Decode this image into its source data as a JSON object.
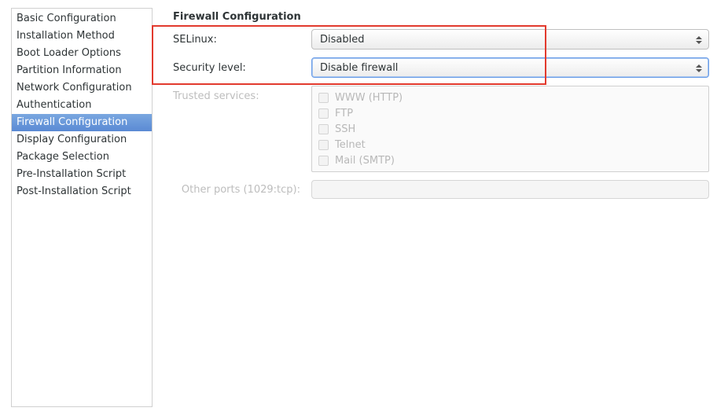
{
  "sidebar": {
    "items": [
      {
        "label": "Basic Configuration"
      },
      {
        "label": "Installation Method"
      },
      {
        "label": "Boot Loader Options"
      },
      {
        "label": "Partition Information"
      },
      {
        "label": "Network Configuration"
      },
      {
        "label": "Authentication"
      },
      {
        "label": "Firewall Configuration"
      },
      {
        "label": "Display Configuration"
      },
      {
        "label": "Package Selection"
      },
      {
        "label": "Pre-Installation Script"
      },
      {
        "label": "Post-Installation Script"
      }
    ],
    "selected_index": 6
  },
  "page": {
    "title": "Firewall Configuration",
    "selinux_label": "SELinux:",
    "selinux_value": "Disabled",
    "security_label": "Security level:",
    "security_value": "Disable firewall",
    "trusted_label": "Trusted services:",
    "trusted_services": [
      {
        "label": "WWW (HTTP)"
      },
      {
        "label": "FTP"
      },
      {
        "label": "SSH"
      },
      {
        "label": "Telnet"
      },
      {
        "label": "Mail (SMTP)"
      }
    ],
    "other_ports_label": "Other ports (1029:tcp):"
  }
}
